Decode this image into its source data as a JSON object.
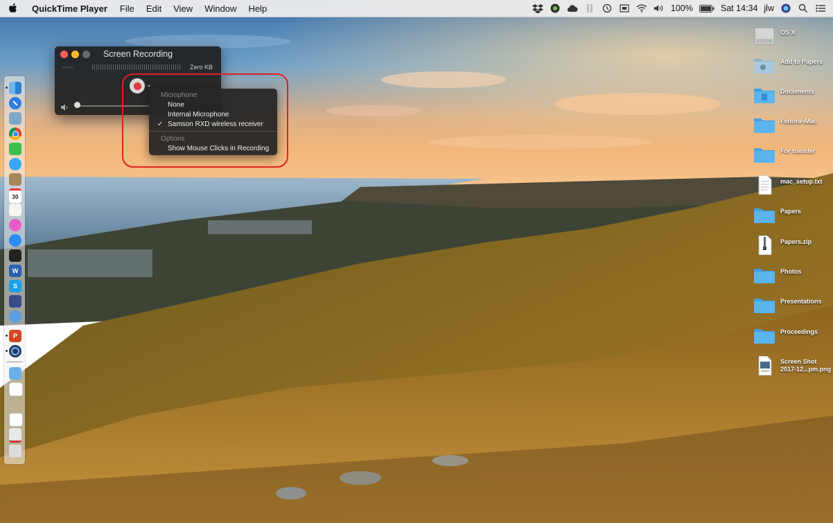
{
  "menubar": {
    "app_name": "QuickTime Player",
    "menus": [
      "File",
      "Edit",
      "View",
      "Window",
      "Help"
    ],
    "battery": "100%",
    "clock": "Sat 14:34",
    "user": "jlw",
    "status_icons": [
      "dropbox-icon",
      "evernote-icon",
      "cloud-icon",
      "pause-icon",
      "time-machine-icon",
      "display-icon",
      "wifi-icon",
      "volume-icon",
      "battery-icon",
      "siri-icon",
      "spotlight-icon",
      "notification-center-icon"
    ]
  },
  "qt_window": {
    "title": "Screen Recording",
    "time": "--:--",
    "size": "Zero KB",
    "record_icon": "record-icon",
    "volume_icon": "speaker-icon"
  },
  "dropdown": {
    "microphone_header": "Microphone",
    "mic_none": "None",
    "mic_internal": "Internal Microphone",
    "mic_samson": "Samson RXD wireless receiver",
    "selected_mark": "✓",
    "options_header": "Options",
    "show_clicks": "Show Mouse Clicks in Recording"
  },
  "desktop_icons": [
    {
      "label": "OS X",
      "icon": "hard-drive-icon"
    },
    {
      "label": "Add to Papers",
      "icon": "folder-icon"
    },
    {
      "label": "Documents",
      "icon": "folder-icon"
    },
    {
      "label": "Fedora-iMac",
      "icon": "folder-icon"
    },
    {
      "label": "For transfer",
      "icon": "folder-icon"
    },
    {
      "label": "mac_setup.txt",
      "icon": "text-file-icon"
    },
    {
      "label": "Papers",
      "icon": "folder-icon"
    },
    {
      "label": "Papers.zip",
      "icon": "zip-file-icon"
    },
    {
      "label": "Photos",
      "icon": "folder-icon"
    },
    {
      "label": "Presentations",
      "icon": "folder-icon"
    },
    {
      "label": "Proceedings",
      "icon": "folder-icon"
    },
    {
      "label": "Screen Shot\n2017-12...pm.png",
      "line1": "Screen Shot",
      "line2": "2017-12...pm.png",
      "icon": "image-file-icon"
    }
  ],
  "dock": {
    "calendar_day": "30",
    "apps": [
      "finder-icon",
      "safari-icon",
      "preview-icon",
      "chrome-icon",
      "facetime-icon",
      "messages-icon",
      "notes-icon",
      "calendar-icon",
      "reminders-icon",
      "itunes-icon",
      "app-store-icon",
      "terminal-icon",
      "word-icon",
      "skype-icon",
      "imovie-icon",
      "simulator-icon",
      "powerpoint-icon",
      "quicktime-icon",
      "mail-icon",
      "document-icon",
      "textedit-icon",
      "document2-icon",
      "printer-icon",
      "trash-icon"
    ]
  },
  "colors": {
    "record_red": "#e0383e",
    "annotation_red": "#e02020",
    "folder_blue": "#5ab4ef"
  }
}
